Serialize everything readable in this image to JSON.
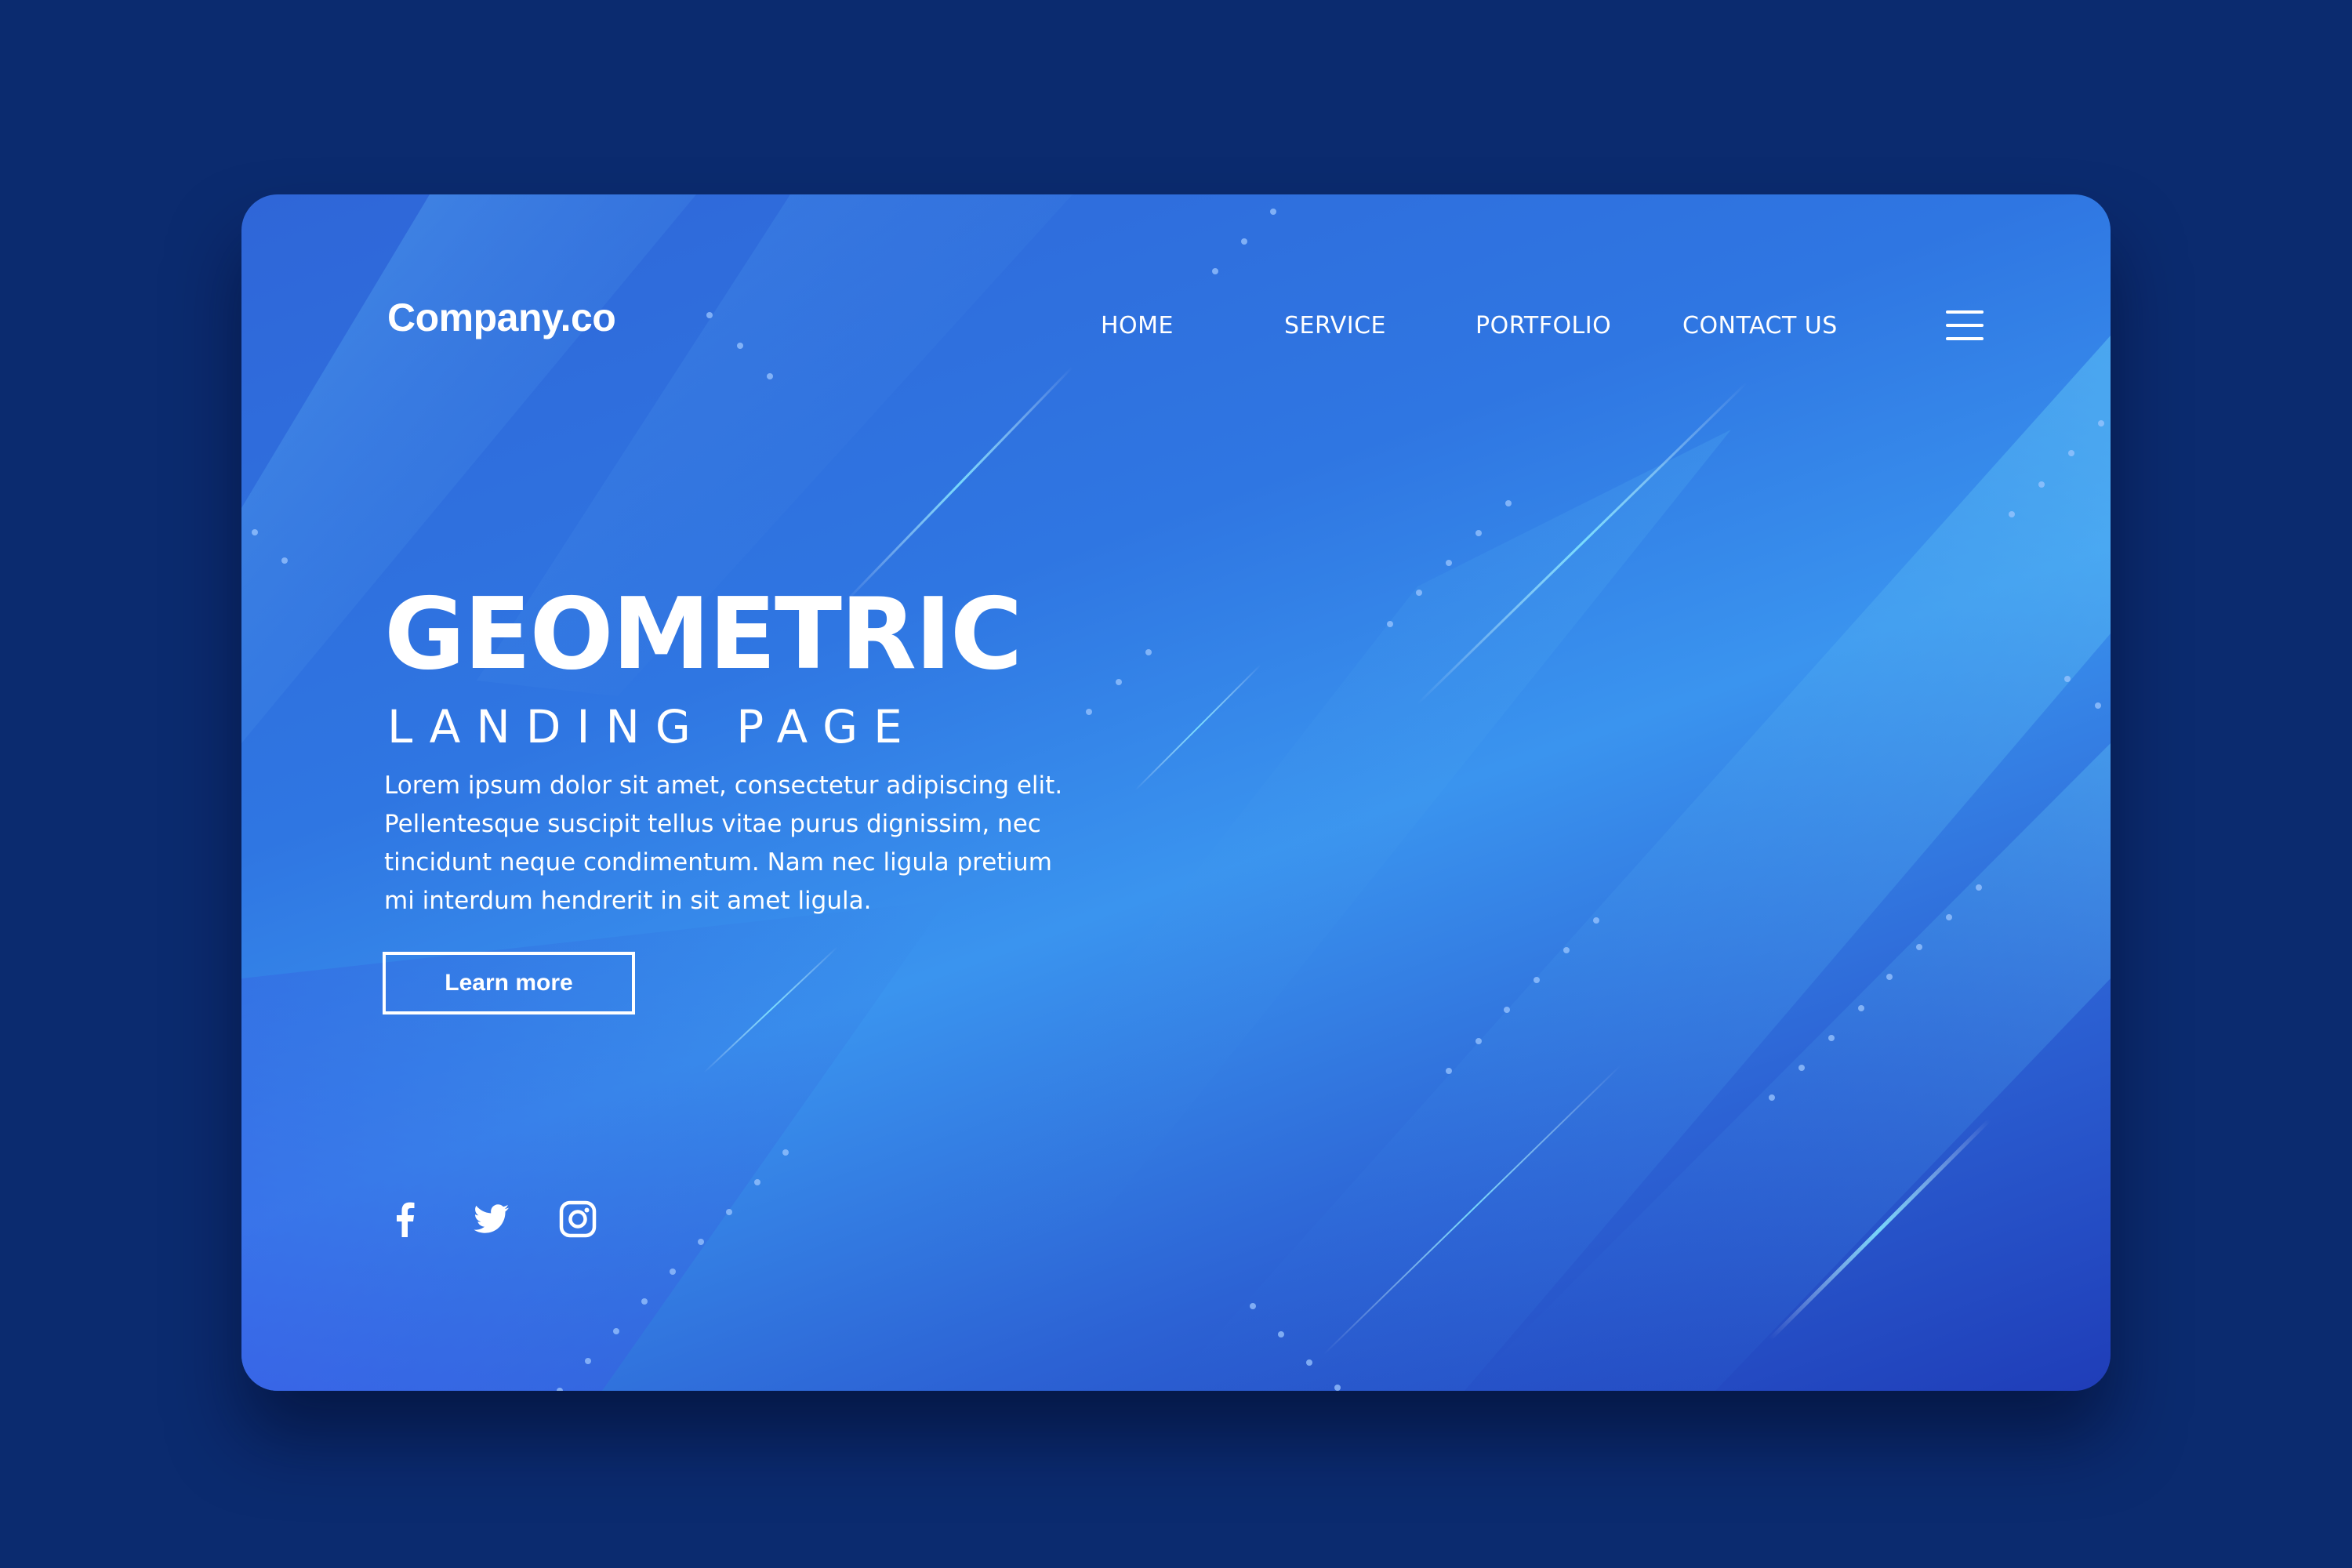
{
  "header": {
    "brand": "Company.co",
    "nav": [
      "HOME",
      "SERVICE",
      "PORTFOLIO",
      "CONTACT US"
    ],
    "menu_icon": "hamburger-menu-icon"
  },
  "hero": {
    "title": "GEOMETRIC",
    "subtitle": "LANDING PAGE",
    "body_lines": [
      "Lorem ipsum dolor sit amet, consectetur adipiscing elit.",
      "Pellentesque suscipit tellus vitae purus dignissim, nec",
      "tincidunt neque condimentum. Nam nec ligula pretium",
      "mi interdum hendrerit in sit amet ligula."
    ],
    "cta_label": "Learn more"
  },
  "social": {
    "icons": [
      "facebook-icon",
      "twitter-icon",
      "instagram-icon"
    ]
  },
  "colors": {
    "page_background": "#0b2b6f",
    "card_gradient_start": "#2f66d8",
    "card_gradient_mid": "#3a94ef",
    "card_gradient_end": "#1f3db8",
    "text": "#ffffff"
  }
}
